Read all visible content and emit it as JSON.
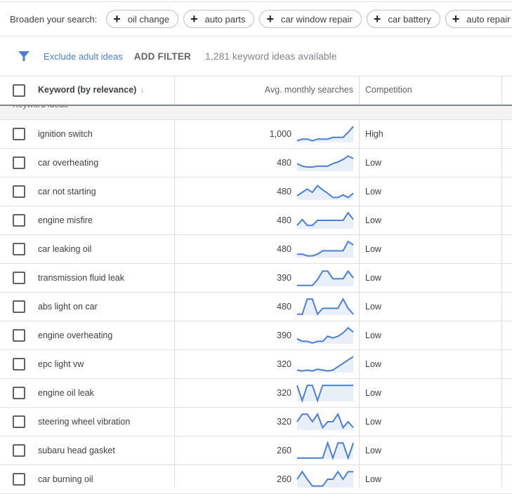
{
  "broaden": {
    "label": "Broaden your search:",
    "chips": [
      "oil change",
      "auto parts",
      "car window repair",
      "car battery",
      "auto repair near me"
    ]
  },
  "filters": {
    "exclude_label": "Exclude adult ideas",
    "add_filter_label": "ADD FILTER",
    "available_text": "1,281 keyword ideas available"
  },
  "table": {
    "columns": {
      "keyword": "Keyword (by relevance)",
      "sort_icon": "arrow-down-icon",
      "avg": "Avg. monthly searches",
      "competition": "Competition"
    },
    "group_label": "Keyword ideas",
    "colors": {
      "spark_line": "#4a7fd1",
      "spark_fill": "#e8eff9"
    },
    "rows": [
      {
        "keyword": "ignition switch",
        "avg": "1,000",
        "competition": "High",
        "trend": [
          0.1,
          0.2,
          0.2,
          0.1,
          0.2,
          0.2,
          0.2,
          0.3,
          0.3,
          0.3,
          0.6,
          0.95
        ]
      },
      {
        "keyword": "car overheating",
        "avg": "480",
        "competition": "Low",
        "trend": [
          0.45,
          0.3,
          0.25,
          0.25,
          0.3,
          0.3,
          0.3,
          0.45,
          0.55,
          0.7,
          0.9,
          0.75
        ]
      },
      {
        "keyword": "car not starting",
        "avg": "480",
        "competition": "Low",
        "trend": [
          0.25,
          0.45,
          0.65,
          0.45,
          0.85,
          0.6,
          0.4,
          0.15,
          0.15,
          0.3,
          0.15,
          0.4
        ]
      },
      {
        "keyword": "engine misfire",
        "avg": "480",
        "competition": "Low",
        "trend": [
          0.2,
          0.55,
          0.2,
          0.2,
          0.5,
          0.5,
          0.5,
          0.5,
          0.5,
          0.5,
          0.95,
          0.55
        ]
      },
      {
        "keyword": "car leaking oil",
        "avg": "480",
        "competition": "Low",
        "trend": [
          0.2,
          0.2,
          0.1,
          0.1,
          0.2,
          0.4,
          0.4,
          0.4,
          0.4,
          0.4,
          0.95,
          0.75
        ]
      },
      {
        "keyword": "transmission fluid leak",
        "avg": "390",
        "competition": "Low",
        "trend": [
          0.05,
          0.05,
          0.05,
          0.05,
          0.4,
          0.9,
          0.9,
          0.45,
          0.45,
          0.45,
          0.9,
          0.5
        ]
      },
      {
        "keyword": "abs light on car",
        "avg": "480",
        "competition": "Low",
        "trend": [
          0.05,
          0.05,
          0.95,
          0.95,
          0.05,
          0.4,
          0.4,
          0.4,
          0.4,
          0.95,
          0.4,
          0.05
        ]
      },
      {
        "keyword": "engine overheating",
        "avg": "390",
        "competition": "Low",
        "trend": [
          0.3,
          0.15,
          0.15,
          0.05,
          0.15,
          0.15,
          0.45,
          0.35,
          0.45,
          0.65,
          0.95,
          0.7
        ]
      },
      {
        "keyword": "epc light vw",
        "avg": "320",
        "competition": "Low",
        "trend": [
          0.15,
          0.1,
          0.15,
          0.1,
          0.2,
          0.15,
          0.1,
          0.15,
          0.35,
          0.55,
          0.75,
          0.95
        ]
      },
      {
        "keyword": "engine oil leak",
        "avg": "320",
        "competition": "Low",
        "trend": [
          0.95,
          0.05,
          0.95,
          0.95,
          0.05,
          0.95,
          0.95,
          0.95,
          0.95,
          0.95,
          0.95,
          0.95
        ]
      },
      {
        "keyword": "steering wheel vibration",
        "avg": "320",
        "competition": "Low",
        "trend": [
          0.5,
          0.95,
          0.95,
          0.5,
          0.95,
          0.15,
          0.5,
          0.5,
          0.95,
          0.15,
          0.5,
          0.15
        ]
      },
      {
        "keyword": "subaru head gasket",
        "avg": "260",
        "competition": "Low",
        "trend": [
          0.05,
          0.05,
          0.05,
          0.05,
          0.05,
          0.05,
          0.95,
          0.05,
          0.95,
          0.95,
          0.05,
          0.95
        ]
      },
      {
        "keyword": "car burning oil",
        "avg": "260",
        "competition": "Low",
        "trend": [
          0.5,
          0.95,
          0.5,
          0.1,
          0.1,
          0.1,
          0.5,
          0.5,
          0.95,
          0.5,
          0.95,
          0.95
        ]
      }
    ]
  }
}
